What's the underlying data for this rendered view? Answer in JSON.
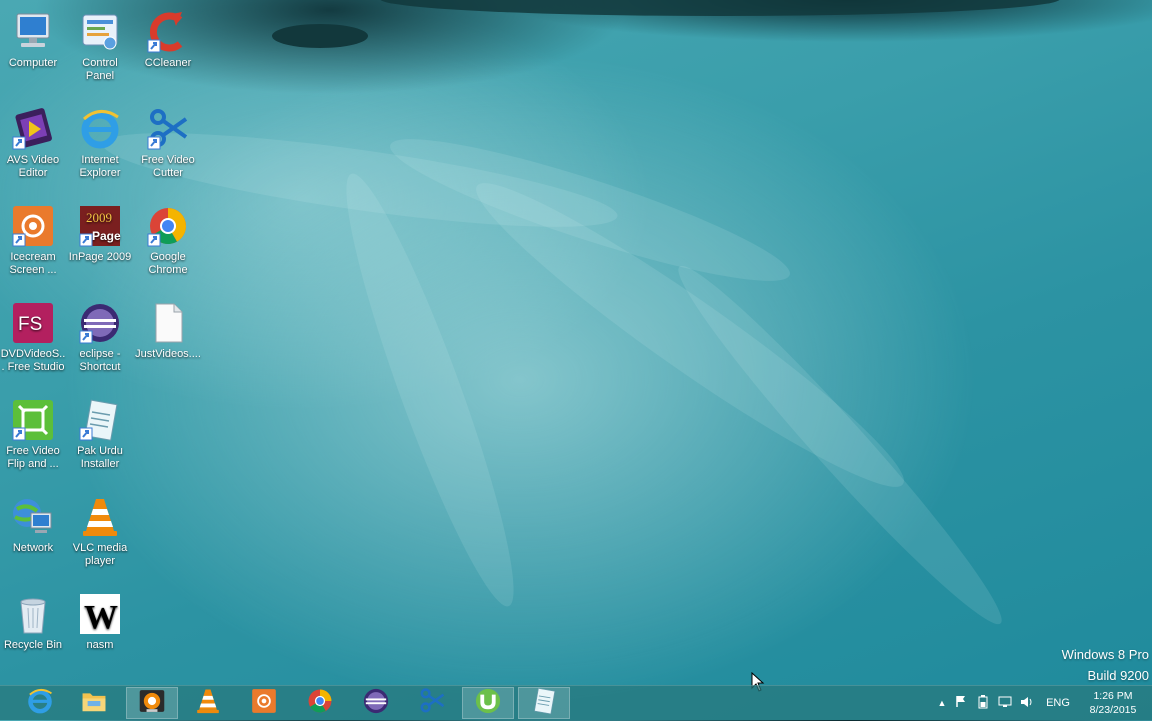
{
  "desktop": {
    "icons": [
      {
        "label": "Computer",
        "icon": "computer-icon"
      },
      {
        "label": "Control Panel",
        "icon": "control-panel-icon"
      },
      {
        "label": "CCleaner",
        "icon": "ccleaner-icon"
      },
      {
        "label": "AVS Video Editor",
        "icon": "avs-video-editor-icon"
      },
      {
        "label": "Internet Explorer",
        "icon": "internet-explorer-icon"
      },
      {
        "label": "Free Video Cutter",
        "icon": "scissors-icon"
      },
      {
        "label": "Icecream Screen ...",
        "icon": "icecream-icon"
      },
      {
        "label": "InPage 2009",
        "icon": "inpage-icon"
      },
      {
        "label": "Google Chrome",
        "icon": "chrome-icon"
      },
      {
        "label": "DVDVideoS... Free Studio",
        "icon": "free-studio-icon"
      },
      {
        "label": "eclipse - Shortcut",
        "icon": "eclipse-icon"
      },
      {
        "label": "JustVideos....",
        "icon": "document-icon"
      },
      {
        "label": "Free Video Flip and ...",
        "icon": "flip-icon"
      },
      {
        "label": "Pak Urdu Installer",
        "icon": "notepad-icon"
      },
      {
        "label": "Network",
        "icon": "network-icon"
      },
      {
        "label": "VLC media player",
        "icon": "vlc-icon"
      },
      {
        "label": "Recycle Bin",
        "icon": "recycle-bin-icon"
      },
      {
        "label": "nasm",
        "icon": "nasm-icon"
      }
    ],
    "nasm_glyph": "W",
    "free_studio_glyph": "FS",
    "inpage_glyph": "Page"
  },
  "watermark": {
    "line1": "Windows 8 Pro",
    "line2": "Build 9200"
  },
  "taskbar": {
    "pinned": [
      {
        "icon": "internet-explorer-icon",
        "active": false
      },
      {
        "icon": "file-explorer-icon",
        "active": false
      },
      {
        "icon": "media-player-icon",
        "active": true
      },
      {
        "icon": "vlc-icon",
        "active": false
      },
      {
        "icon": "icecream-icon",
        "active": false
      },
      {
        "icon": "chrome-icon",
        "active": false
      },
      {
        "icon": "eclipse-icon",
        "active": false
      },
      {
        "icon": "scissors-icon",
        "active": false
      },
      {
        "icon": "utorrent-icon",
        "active": false
      },
      {
        "icon": "notepad-icon",
        "active": false
      }
    ],
    "tray": {
      "language": "ENG",
      "time": "1:26 PM",
      "date": "8/23/2015"
    }
  },
  "colors": {
    "taskbar": "#2a7d84",
    "wallpaper": "#3a9eab"
  }
}
